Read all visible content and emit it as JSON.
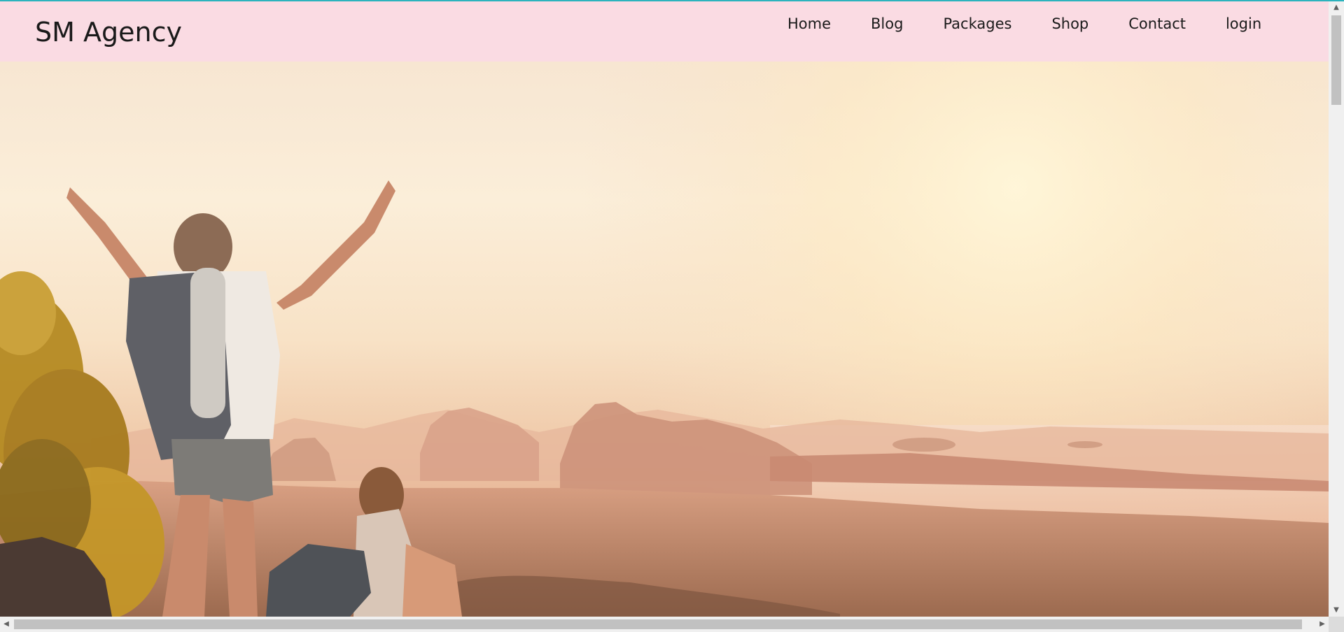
{
  "header": {
    "brand": "SM Agency",
    "nav": [
      {
        "label": "Home"
      },
      {
        "label": "Blog"
      },
      {
        "label": "Packages"
      },
      {
        "label": "Shop"
      },
      {
        "label": "Contact"
      },
      {
        "label": "login"
      }
    ]
  },
  "colors": {
    "navbar_bg": "#fadbe3",
    "accent_line": "#2bb3bd",
    "text": "#1a1a1a"
  },
  "icons": {
    "scroll_up": "▲",
    "scroll_down": "▼",
    "scroll_left": "◀",
    "scroll_right": "▶"
  }
}
